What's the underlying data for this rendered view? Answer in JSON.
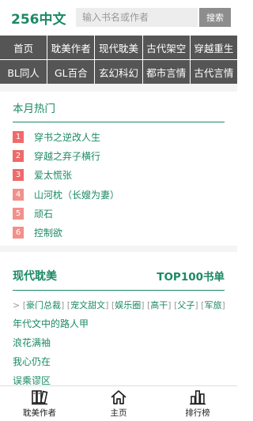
{
  "header": {
    "logo": "256中文",
    "search_placeholder": "输入书名或作者",
    "search_button": "搜索"
  },
  "nav": {
    "rows": [
      [
        "首页",
        "耽美作者",
        "现代耽美",
        "古代架空",
        "穿越重生"
      ],
      [
        "BL同人",
        "GL百合",
        "玄幻科幻",
        "都市言情",
        "古代言情"
      ]
    ]
  },
  "hot": {
    "title": "本月热门",
    "items": [
      {
        "rank": "1",
        "title": "穿书之逆改人生"
      },
      {
        "rank": "2",
        "title": "穿越之弃子横行"
      },
      {
        "rank": "3",
        "title": "爱太慌张"
      },
      {
        "rank": "4",
        "title": "山河枕（长嫂为妻）"
      },
      {
        "rank": "5",
        "title": "顽石"
      },
      {
        "rank": "6",
        "title": "控制欲"
      }
    ]
  },
  "modern": {
    "title": "现代耽美",
    "top100": "TOP100书单",
    "tags_prefix": ">",
    "tags": [
      "豪门总裁",
      "宠文甜文",
      "娱乐圈",
      "高干",
      "父子",
      "军旅"
    ],
    "books": [
      "年代文中的路人甲",
      "浪花满袖",
      "我心仍在",
      "误乘谬区"
    ]
  },
  "tabbar": {
    "items": [
      {
        "label": "耽美作者",
        "icon": "books-icon"
      },
      {
        "label": "主页",
        "icon": "home-icon"
      },
      {
        "label": "排行榜",
        "icon": "ranking-icon"
      }
    ]
  },
  "colors": {
    "accent": "#1c8a63",
    "nav_bg": "#555555",
    "rank_hot": "#ef6a6a",
    "rank_normal": "#f2908a"
  }
}
